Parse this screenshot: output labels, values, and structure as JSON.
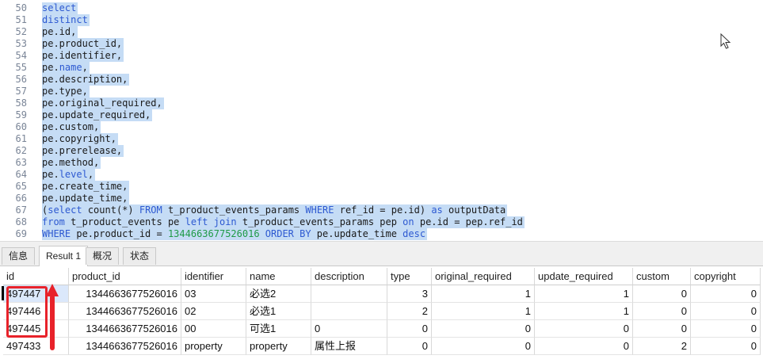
{
  "editor": {
    "lines": [
      {
        "n": "50",
        "segs": [
          {
            "t": "select",
            "k": "kw"
          }
        ]
      },
      {
        "n": "51",
        "segs": [
          {
            "t": "distinct",
            "k": "kw"
          }
        ]
      },
      {
        "n": "52",
        "segs": [
          {
            "t": "pe.id,",
            "k": ""
          }
        ]
      },
      {
        "n": "53",
        "segs": [
          {
            "t": "pe.product_id,",
            "k": ""
          }
        ]
      },
      {
        "n": "54",
        "segs": [
          {
            "t": "pe.identifier,",
            "k": ""
          }
        ]
      },
      {
        "n": "55",
        "segs": [
          {
            "t": "pe.",
            "k": ""
          },
          {
            "t": "name",
            "k": "kw"
          },
          {
            "t": ",",
            "k": ""
          }
        ]
      },
      {
        "n": "56",
        "segs": [
          {
            "t": "pe.description,",
            "k": ""
          }
        ]
      },
      {
        "n": "57",
        "segs": [
          {
            "t": "pe.type,",
            "k": ""
          }
        ]
      },
      {
        "n": "58",
        "segs": [
          {
            "t": "pe.original_required,",
            "k": ""
          }
        ]
      },
      {
        "n": "59",
        "segs": [
          {
            "t": "pe.update_required,",
            "k": ""
          }
        ]
      },
      {
        "n": "60",
        "segs": [
          {
            "t": "pe.custom,",
            "k": ""
          }
        ]
      },
      {
        "n": "61",
        "segs": [
          {
            "t": "pe.copyright,",
            "k": ""
          }
        ]
      },
      {
        "n": "62",
        "segs": [
          {
            "t": "pe.prerelease,",
            "k": ""
          }
        ]
      },
      {
        "n": "63",
        "segs": [
          {
            "t": "pe.method,",
            "k": ""
          }
        ]
      },
      {
        "n": "64",
        "segs": [
          {
            "t": "pe.",
            "k": ""
          },
          {
            "t": "level",
            "k": "kw"
          },
          {
            "t": ",",
            "k": ""
          }
        ]
      },
      {
        "n": "65",
        "segs": [
          {
            "t": "pe.create_time,",
            "k": ""
          }
        ]
      },
      {
        "n": "66",
        "segs": [
          {
            "t": "pe.update_time,",
            "k": ""
          }
        ]
      },
      {
        "n": "67",
        "segs": [
          {
            "t": "(",
            "k": ""
          },
          {
            "t": "select",
            "k": "kw"
          },
          {
            "t": " count(*) ",
            "k": ""
          },
          {
            "t": "FROM",
            "k": "kw"
          },
          {
            "t": " t_product_events_params ",
            "k": ""
          },
          {
            "t": "WHERE",
            "k": "kw"
          },
          {
            "t": " ref_id = pe.id) ",
            "k": ""
          },
          {
            "t": "as",
            "k": "kw"
          },
          {
            "t": " outputData",
            "k": ""
          }
        ]
      },
      {
        "n": "68",
        "segs": [
          {
            "t": "from",
            "k": "kw"
          },
          {
            "t": " t_product_events pe ",
            "k": ""
          },
          {
            "t": "left join",
            "k": "kw"
          },
          {
            "t": " t_product_events_params pep ",
            "k": ""
          },
          {
            "t": "on",
            "k": "kw"
          },
          {
            "t": " pe.id = pep.ref_id",
            "k": ""
          }
        ]
      },
      {
        "n": "69",
        "segs": [
          {
            "t": "WHERE",
            "k": "kw"
          },
          {
            "t": " pe.product_id = ",
            "k": ""
          },
          {
            "t": "1344663677526016",
            "k": "num"
          },
          {
            "t": " ",
            "k": ""
          },
          {
            "t": "ORDER BY",
            "k": "kw"
          },
          {
            "t": " pe.update_time ",
            "k": ""
          },
          {
            "t": "desc",
            "k": "kw"
          }
        ]
      }
    ]
  },
  "tabs": [
    "信息",
    "Result 1",
    "概况",
    "状态"
  ],
  "active_tab": "Result 1",
  "grid": {
    "columns": [
      "id",
      "product_id",
      "identifier",
      "name",
      "description",
      "type",
      "original_required",
      "update_required",
      "custom",
      "copyright"
    ],
    "rows": [
      [
        "497447",
        "1344663677526016",
        "03",
        "必选2",
        "",
        "3",
        "1",
        "1",
        "0",
        "0"
      ],
      [
        "497446",
        "1344663677526016",
        "02",
        "必选1",
        "",
        "2",
        "1",
        "1",
        "0",
        "0"
      ],
      [
        "497445",
        "1344663677526016",
        "00",
        "可选1",
        "0",
        "0",
        "0",
        "0",
        "0",
        "0"
      ],
      [
        "497433",
        "1344663677526016",
        "property",
        "property",
        "属性上报",
        "0",
        "0",
        "0",
        "2",
        "0"
      ]
    ]
  },
  "colors": {
    "selection": "#c5dcf5",
    "keyword": "#2d59d1",
    "number": "#1f9a47",
    "annotation": "#e8222a"
  }
}
